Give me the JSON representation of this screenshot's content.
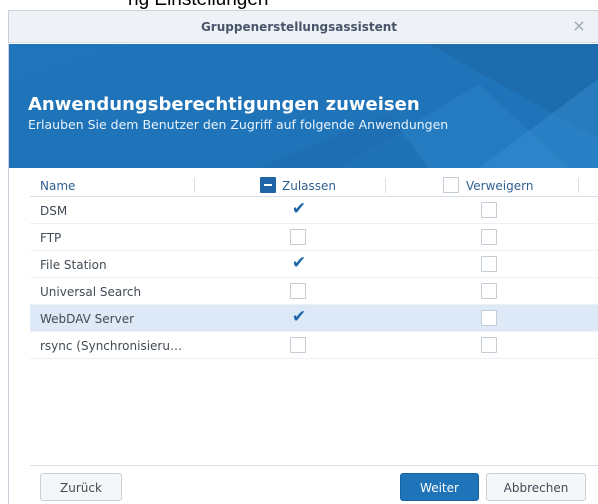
{
  "app": {
    "background_caption": "ng Einstellungen"
  },
  "dialog": {
    "title": "Gruppenerstellungsassistent",
    "close_symbol": "×"
  },
  "banner": {
    "heading": "Anwendungsberechtigungen zuweisen",
    "subheading": "Erlauben Sie dem Benutzer den Zugriff auf folgende Anwendungen",
    "color": "#1f73b8"
  },
  "grid": {
    "columns": {
      "name": "Name",
      "allow": "Zulassen",
      "deny": "Verweigern"
    },
    "allow_header_state": "indeterminate",
    "deny_header_state": "unchecked",
    "rows": [
      {
        "name": "DSM",
        "allow": true,
        "deny": false,
        "selected": false
      },
      {
        "name": "FTP",
        "allow": false,
        "deny": false,
        "selected": false
      },
      {
        "name": "File Station",
        "allow": true,
        "deny": false,
        "selected": false
      },
      {
        "name": "Universal Search",
        "allow": false,
        "deny": false,
        "selected": false
      },
      {
        "name": "WebDAV Server",
        "allow": true,
        "deny": false,
        "selected": true
      },
      {
        "name": "rsync (Synchronisieru…",
        "allow": false,
        "deny": false,
        "selected": false
      }
    ]
  },
  "buttons": {
    "back": "Zurück",
    "next": "Weiter",
    "cancel": "Abbrechen"
  },
  "icons": {
    "check": "checkmark-icon",
    "close": "close-icon"
  }
}
